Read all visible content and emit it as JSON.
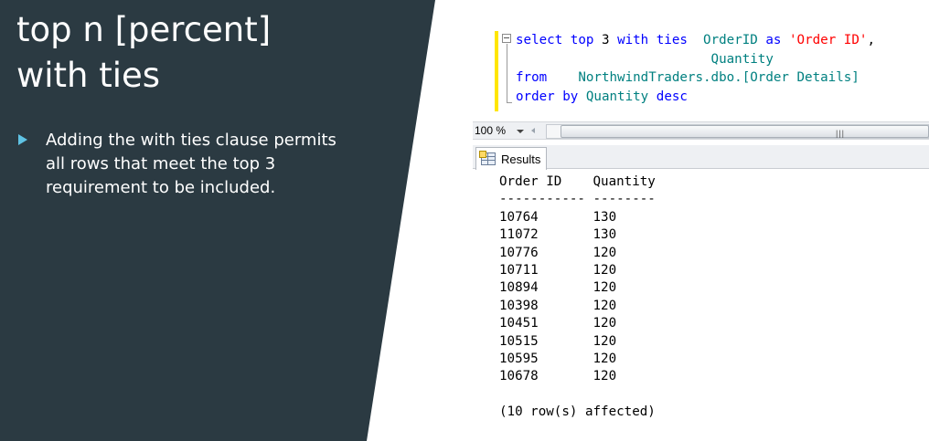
{
  "slide": {
    "title_line1": "top n [percent]",
    "title_line2": "with ties",
    "bullet": "Adding the with ties clause permits all rows that meet the top 3 requirement to be included.",
    "colors": {
      "panel": "#2b3a42",
      "bullet_marker": "#5fc3e4"
    }
  },
  "editor": {
    "line1": {
      "kw1": "select",
      "kw2": "top",
      "num": "3",
      "kw3": "with ties",
      "col1": "OrderID",
      "kw4": "as",
      "alias": "'Order ID'",
      "comma": ","
    },
    "line2": {
      "col2": "Quantity"
    },
    "line3": {
      "kw": "from",
      "table": "NorthwindTraders.dbo.[Order Details]"
    },
    "line4": {
      "kw": "order by",
      "col": "Quantity",
      "dir": "desc"
    }
  },
  "zoom": {
    "level": "100 %"
  },
  "results_tab": {
    "label": "Results",
    "icon": "results-grid-icon"
  },
  "results": {
    "header": "Order ID    Quantity",
    "separator": "----------- --------",
    "rows": [
      "10764       130",
      "11072       130",
      "10776       120",
      "10711       120",
      "10894       120",
      "10398       120",
      "10451       120",
      "10515       120",
      "10595       120",
      "10678       120"
    ],
    "footer": "(10 row(s) affected)"
  }
}
